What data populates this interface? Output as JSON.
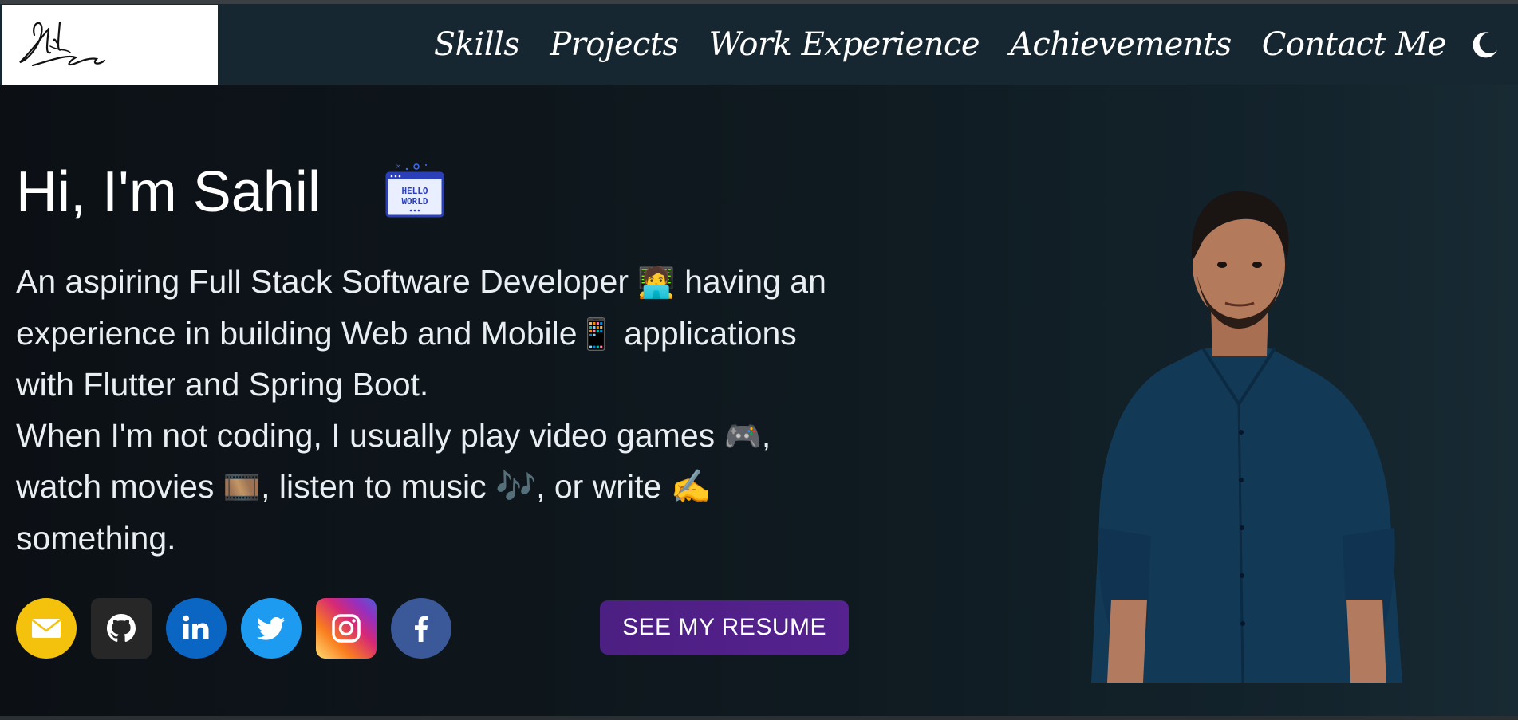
{
  "logo": {
    "alt": "Sahil Samuel signature"
  },
  "nav": {
    "items": [
      {
        "label": "Skills"
      },
      {
        "label": "Projects"
      },
      {
        "label": "Work Experience"
      },
      {
        "label": "Achievements"
      },
      {
        "label": "Contact Me"
      }
    ],
    "theme_toggle_icon": "moon-icon"
  },
  "hero": {
    "title": "Hi, I'm Sahil",
    "hello_badge": "HELLO WORLD",
    "bio_lines": [
      {
        "text_a": "An aspiring Full Stack Software Developer ",
        "emoji": "🧑‍💻",
        "text_b": " having an"
      },
      {
        "text_a": "experience in building Web and Mobile",
        "emoji": "📱",
        "text_b": " applications"
      },
      {
        "text_a": "with Flutter and Spring Boot.",
        "emoji": "",
        "text_b": ""
      },
      {
        "text_a": "When I'm not coding, I usually play video games ",
        "emoji": "🎮",
        "text_b": ","
      },
      {
        "text_a": "watch movies ",
        "emoji": "🎞️",
        "text_b": ", listen to music 🎶, or write ✍️"
      },
      {
        "text_a": "something.",
        "emoji": "",
        "text_b": ""
      }
    ],
    "socials": [
      {
        "name": "email",
        "icon": "envelope-icon",
        "color": "#f4c20d"
      },
      {
        "name": "github",
        "icon": "github-icon",
        "color": "#272727"
      },
      {
        "name": "linkedin",
        "icon": "linkedin-icon",
        "color": "#0a66c2"
      },
      {
        "name": "twitter",
        "icon": "twitter-icon",
        "color": "#1d9bf0"
      },
      {
        "name": "instagram",
        "icon": "instagram-icon",
        "color": "#d62976"
      },
      {
        "name": "facebook",
        "icon": "facebook-icon",
        "color": "#3b5998"
      }
    ],
    "resume_button": "SEE MY RESUME"
  },
  "colors": {
    "navbar_bg": "#172731",
    "page_bg": "#0d1419",
    "accent_button": "#4c1f82"
  }
}
